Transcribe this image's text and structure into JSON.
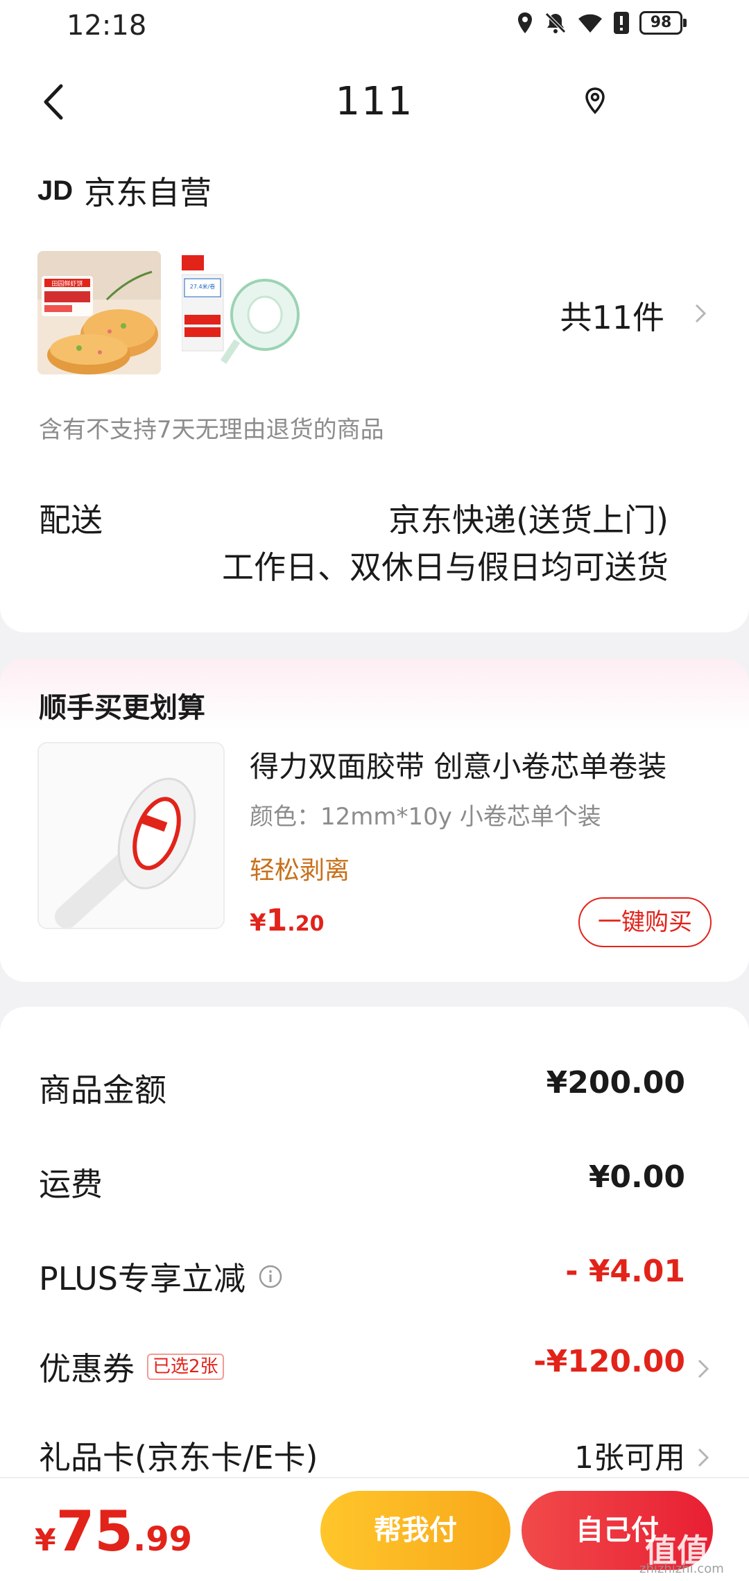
{
  "status_bar": {
    "time": "12:18",
    "battery": "98"
  },
  "nav": {
    "title": "111"
  },
  "shop": {
    "logo": "JD",
    "name": "京东自营",
    "item_count": "共11件",
    "return_note": "含有不支持7天无理由退货的商品",
    "delivery_label": "配送",
    "delivery_method": "京东快递(送货上门)",
    "delivery_time": "工作日、双休日与假日均可送货",
    "thumb1_text": "田园鲜虾饼",
    "thumb2_text": "27.4米/卷"
  },
  "promo": {
    "title": "顺手买更划算",
    "product_name": "得力双面胶带 创意小卷芯单卷装",
    "spec": "颜色：12mm*10y 小卷芯单个装",
    "tag": "轻松剥离",
    "price_currency": "¥",
    "price_int": "1",
    "price_dec": ".20",
    "buy_label": "一键购买"
  },
  "summary": {
    "goods_label": "商品金额",
    "goods_value": "¥200.00",
    "shipping_label": "运费",
    "shipping_value": "¥0.00",
    "plus_label": "PLUS专享立减",
    "plus_value": "- ¥4.01",
    "coupon_label": "优惠券",
    "coupon_badge": "已选2张",
    "coupon_value": "-¥120.00",
    "giftcard_label": "礼品卡(京东卡/E卡)",
    "giftcard_value": "1张可用"
  },
  "bottom": {
    "currency": "¥",
    "total_int": "75",
    "total_dec": ".99",
    "help_pay_label": "帮我付",
    "self_pay_label": "自己付"
  },
  "watermark": {
    "main": "值值值",
    "sub": "zhizhizhi.com"
  },
  "colors": {
    "accent_red": "#e2231a",
    "accent_orange": "#c8701c",
    "pay_yellow": "#f8a81a"
  }
}
